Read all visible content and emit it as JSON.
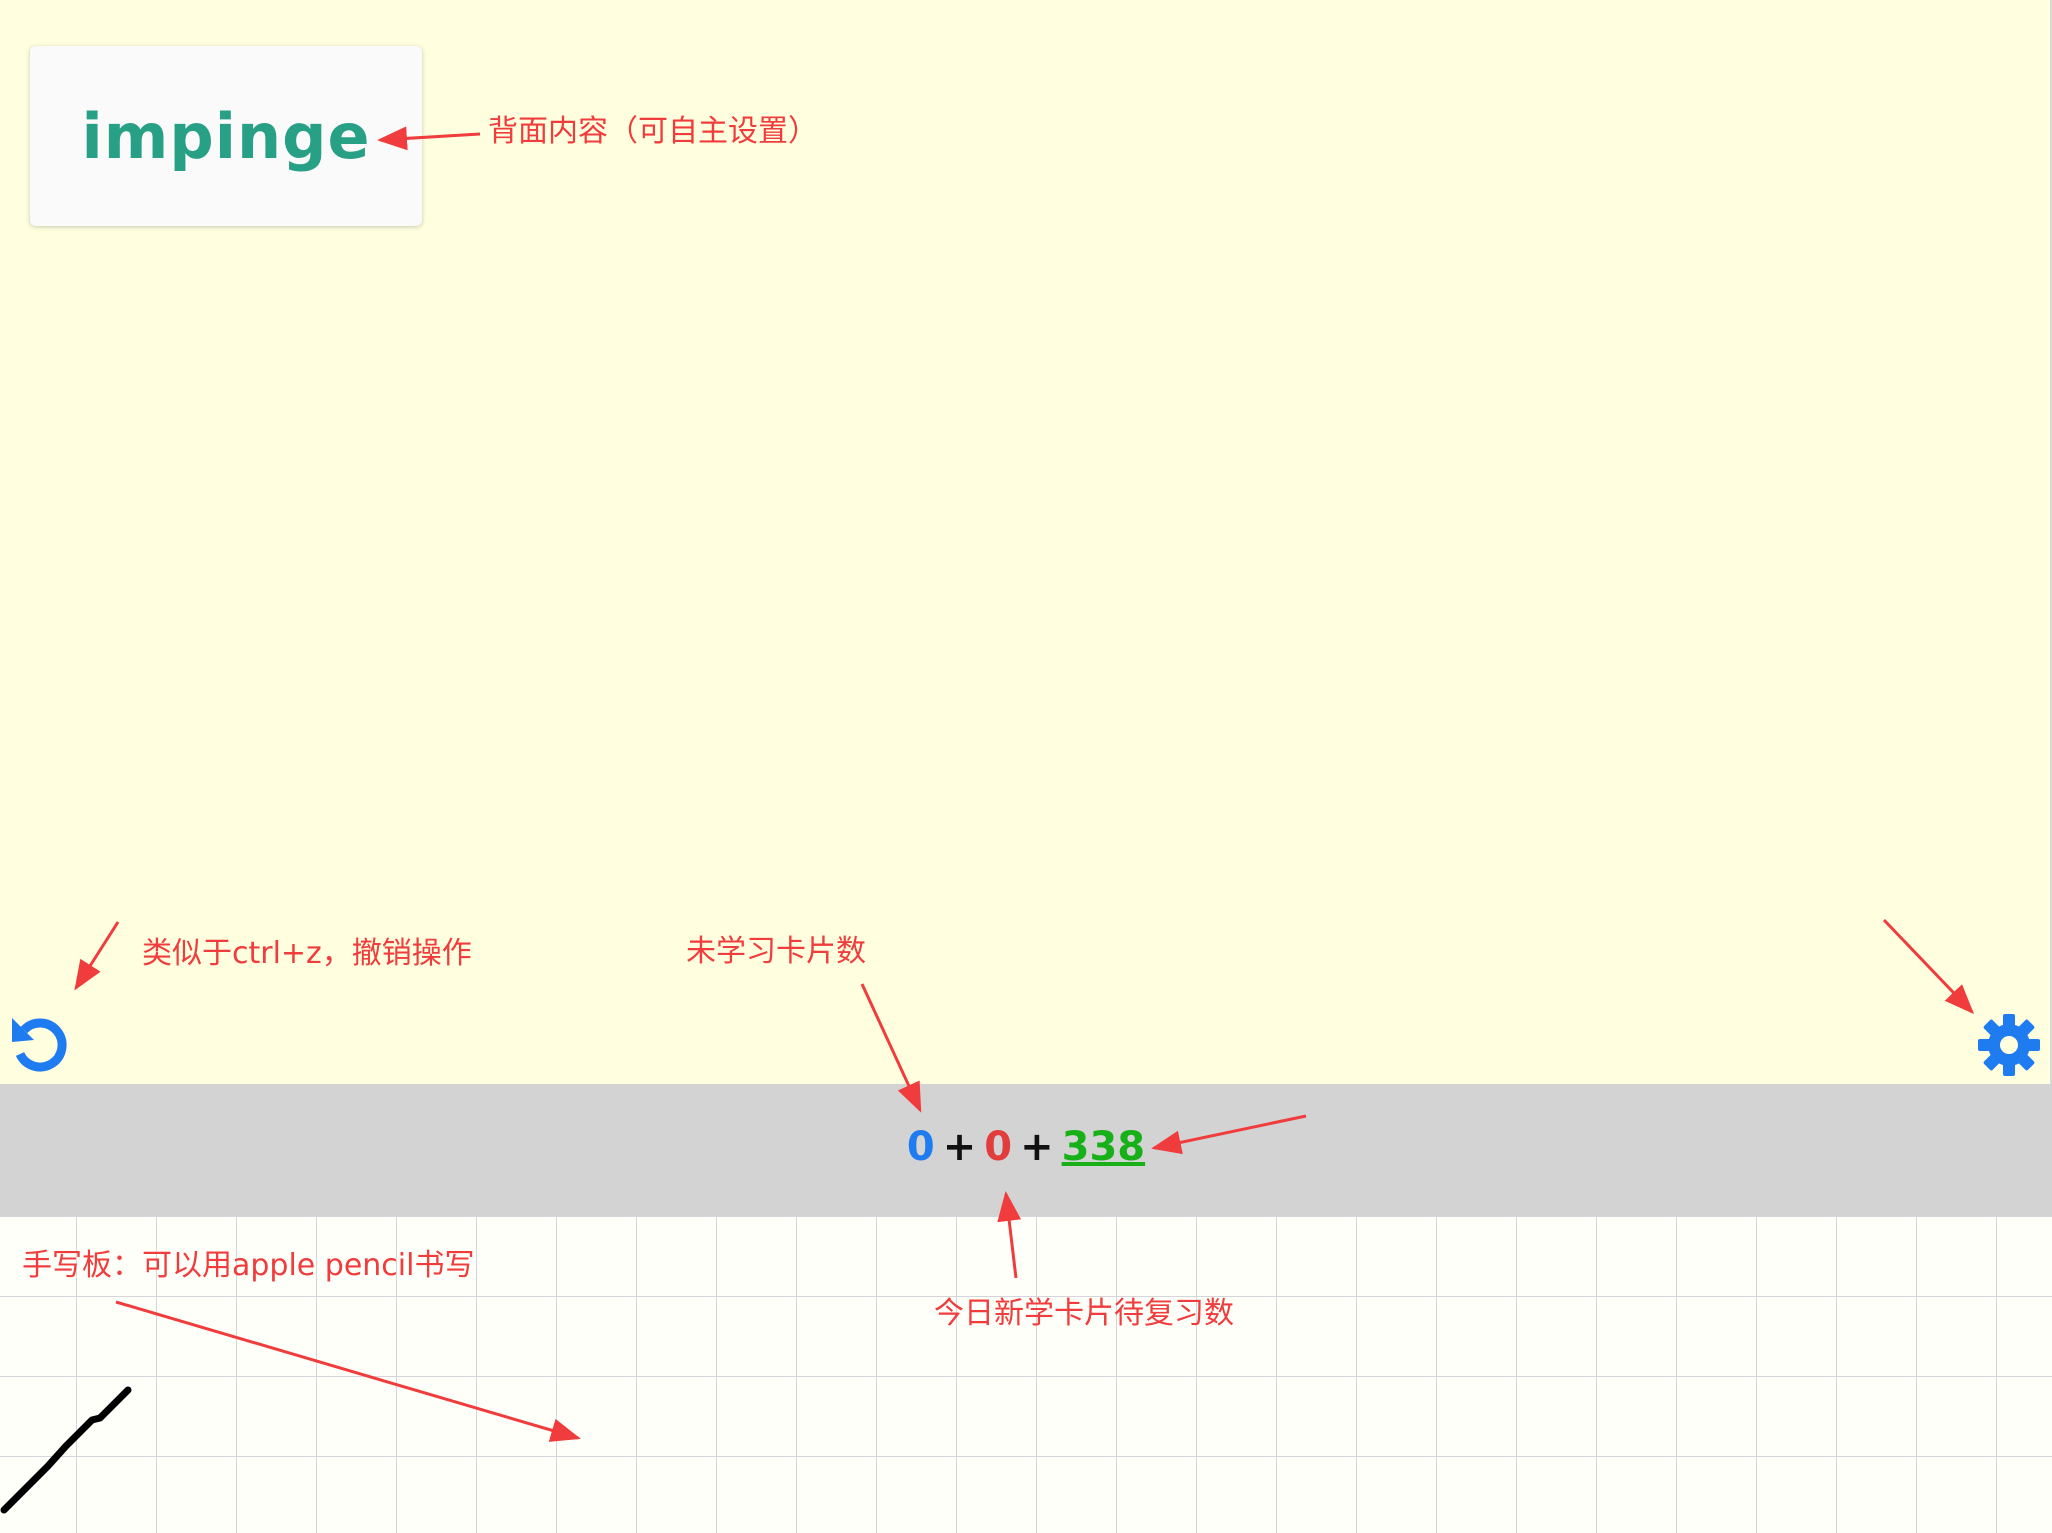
{
  "card": {
    "back_text": "impinge"
  },
  "counter": {
    "new_count": "0",
    "learning_count": "0",
    "review_count": "338",
    "separator": "+",
    "colors": {
      "new": "#1e7cf0",
      "learning": "#e23d3d",
      "review": "#18b018"
    }
  },
  "toolbar": {
    "undo_icon": "undo-icon",
    "settings_icon": "gear-icon",
    "accent_color": "#1e7cf0"
  },
  "annotations": {
    "back_content": "背面内容（可自主设置）",
    "undo": "类似于ctrl+z，撤销操作",
    "new_cards": "未学习卡片数",
    "review_today": "今日新学卡片待复习数",
    "handwriting": "手写板：可以用apple pencil书写",
    "color": "#f03c3c"
  },
  "colors": {
    "card_background": "#ffffdf",
    "counter_bar": "#d3d3d3",
    "word_color": "#27a085"
  }
}
